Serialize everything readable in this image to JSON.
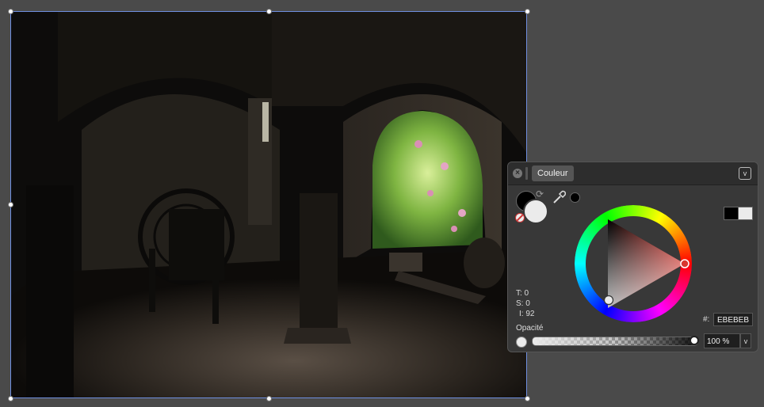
{
  "panel": {
    "close_label": "×",
    "tab_label": "Couleur",
    "menu_label": "v"
  },
  "color": {
    "fill": "#EBEBEB",
    "stroke": "#000000",
    "swap_glyph": "⟳",
    "hue": 0,
    "saturation": 0,
    "intensity": 92
  },
  "readouts": {
    "t": "T: 0",
    "s": "S: 0",
    "i": "I: 92"
  },
  "hex": {
    "label": "#:",
    "value": "EBEBEB"
  },
  "opacity": {
    "label": "Opacité",
    "value_text": "100 %",
    "value": 1.0,
    "dropdown_glyph": "v"
  },
  "icons": {
    "eyedropper": "eyedropper-icon",
    "close": "close-icon",
    "menu": "chevron-down-icon",
    "swap": "swap-icon",
    "none": "no-color-icon"
  }
}
